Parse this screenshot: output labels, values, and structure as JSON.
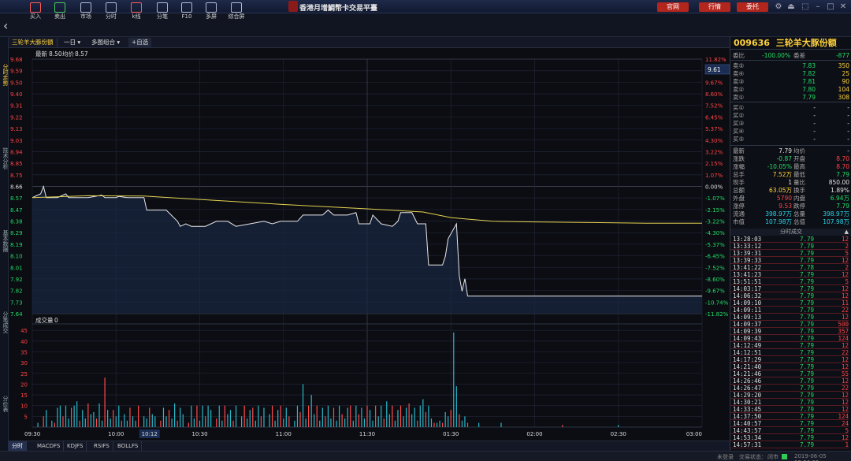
{
  "app": {
    "title": "香港月增鯛幣卡交易平臺"
  },
  "top_buttons": [
    "官网",
    "行情",
    "委托"
  ],
  "toolbar": [
    {
      "label": "买入",
      "icon": "house-icon"
    },
    {
      "label": "卖出",
      "icon": "house-icon"
    },
    {
      "label": "市场",
      "icon": "bag-icon"
    },
    {
      "label": "分时",
      "icon": "chart-icon"
    },
    {
      "label": "k线",
      "icon": "candle-icon"
    },
    {
      "label": "分笔",
      "icon": "list-icon"
    },
    {
      "label": "F10",
      "icon": "doc-icon"
    },
    {
      "label": "多屏",
      "icon": "window-icon"
    },
    {
      "label": "综合屏",
      "icon": "grid-icon"
    }
  ],
  "left_tabs": [
    "分时走势",
    "技术分析",
    "基本数据",
    "分笔成交",
    "分价表"
  ],
  "subtabs": {
    "stock": "三轮羊大豚份額",
    "period": "一日",
    "overlay": "多图组合",
    "add": "+自选"
  },
  "info_line": {
    "last_label": "最新",
    "last": "8.50",
    "avg_label": "均价",
    "avg": "8.57"
  },
  "current_price_tag": "9.61",
  "volume_label": "成交量",
  "volume_value": "0",
  "bottom_tabs": [
    "分时",
    "MACDFS",
    "KDJFS",
    "RSIFS",
    "BOLLFS"
  ],
  "status": {
    "left": "未登录",
    "state_label": "交易状态：",
    "state": "闭市",
    "datetime": "2019-06-05 15:26:32"
  },
  "chart_data": {
    "type": "line",
    "x_ticks": [
      "09:30",
      "10:00",
      "10:12",
      "10:30",
      "11:00",
      "11:30",
      "01:30",
      "02:00",
      "02:30",
      "03:00"
    ],
    "price_ticks": [
      "9.68",
      "9.59",
      "9.50",
      "9.40",
      "9.31",
      "9.22",
      "9.13",
      "9.03",
      "8.94",
      "8.85",
      "8.75",
      "8.66",
      "8.57",
      "8.47",
      "8.38",
      "8.29",
      "8.19",
      "8.10",
      "8.01",
      "7.92",
      "7.82",
      "7.73",
      "7.64"
    ],
    "pct_ticks": [
      "11.82%",
      "10.74%",
      "9.67%",
      "8.60%",
      "7.52%",
      "6.45%",
      "5.37%",
      "4.30%",
      "3.22%",
      "2.15%",
      "1.07%",
      "0.00%",
      "-1.07%",
      "-2.15%",
      "-3.22%",
      "-4.30%",
      "-5.37%",
      "-6.45%",
      "-7.52%",
      "-8.60%",
      "-9.67%",
      "-10.74%",
      "-11.82%"
    ],
    "ylim": [
      7.64,
      9.68
    ],
    "prev_close": 8.66,
    "volume_ticks": [
      "45",
      "40",
      "35",
      "30",
      "25",
      "20",
      "15",
      "10",
      "5"
    ],
    "volume_ylim": [
      0,
      48
    ],
    "price_series": [
      [
        0,
        8.57
      ],
      [
        3,
        8.6
      ],
      [
        4,
        8.66
      ],
      [
        5,
        8.57
      ],
      [
        9,
        8.57
      ],
      [
        12,
        8.6
      ],
      [
        13,
        8.57
      ],
      [
        20,
        8.57
      ],
      [
        25,
        8.59
      ],
      [
        26,
        8.57
      ],
      [
        30,
        8.57
      ],
      [
        31,
        8.58
      ],
      [
        34,
        8.57
      ],
      [
        40,
        8.57
      ],
      [
        41,
        8.47
      ],
      [
        48,
        8.47
      ],
      [
        52,
        8.38
      ],
      [
        53,
        8.34
      ],
      [
        55,
        8.36
      ],
      [
        57,
        8.34
      ],
      [
        62,
        8.34
      ],
      [
        66,
        8.38
      ],
      [
        70,
        8.38
      ],
      [
        73,
        8.34
      ],
      [
        78,
        8.36
      ],
      [
        83,
        8.38
      ],
      [
        86,
        8.36
      ],
      [
        89,
        8.38
      ],
      [
        92,
        8.38
      ],
      [
        95,
        8.38
      ],
      [
        97,
        8.43
      ],
      [
        104,
        8.43
      ],
      [
        106,
        8.47
      ],
      [
        108,
        8.43
      ],
      [
        113,
        8.43
      ],
      [
        116,
        8.45
      ],
      [
        117,
        8.36
      ],
      [
        121,
        8.36
      ],
      [
        122,
        8.43
      ],
      [
        125,
        8.36
      ],
      [
        129,
        8.34
      ],
      [
        131,
        8.38
      ],
      [
        132,
        8.45
      ],
      [
        136,
        8.45
      ],
      [
        138,
        8.36
      ],
      [
        141,
        8.36
      ],
      [
        142,
        8.03
      ],
      [
        147,
        8.03
      ],
      [
        148,
        8.1
      ],
      [
        149,
        8.24
      ],
      [
        152,
        8.36
      ],
      [
        153,
        7.94
      ],
      [
        154,
        7.82
      ],
      [
        155,
        7.92
      ],
      [
        156,
        7.78
      ],
      [
        240,
        7.78
      ]
    ],
    "avg_series": [
      [
        0,
        8.57
      ],
      [
        20,
        8.585
      ],
      [
        40,
        8.583
      ],
      [
        60,
        8.555
      ],
      [
        90,
        8.515
      ],
      [
        120,
        8.48
      ],
      [
        140,
        8.455
      ],
      [
        150,
        8.41
      ],
      [
        155,
        8.4
      ],
      [
        165,
        8.38
      ],
      [
        180,
        8.375
      ],
      [
        220,
        8.365
      ],
      [
        240,
        8.365
      ]
    ],
    "volume_bars": [
      [
        2,
        2
      ],
      [
        4,
        5
      ],
      [
        5,
        8
      ],
      [
        7,
        3
      ],
      [
        8,
        2
      ],
      [
        9,
        9
      ],
      [
        10,
        10
      ],
      [
        11,
        5
      ],
      [
        12,
        10
      ],
      [
        13,
        4
      ],
      [
        14,
        9
      ],
      [
        15,
        10
      ],
      [
        16,
        12
      ],
      [
        17,
        3
      ],
      [
        18,
        8
      ],
      [
        19,
        4
      ],
      [
        20,
        11
      ],
      [
        21,
        6
      ],
      [
        22,
        7
      ],
      [
        23,
        4
      ],
      [
        24,
        11
      ],
      [
        25,
        3
      ],
      [
        26,
        23
      ],
      [
        27,
        8
      ],
      [
        28,
        4
      ],
      [
        29,
        8
      ],
      [
        30,
        5
      ],
      [
        31,
        10
      ],
      [
        32,
        3
      ],
      [
        33,
        6
      ],
      [
        34,
        3
      ],
      [
        35,
        9
      ],
      [
        36,
        5
      ],
      [
        37,
        3
      ],
      [
        38,
        10
      ],
      [
        40,
        5
      ],
      [
        41,
        4
      ],
      [
        42,
        9
      ],
      [
        43,
        6
      ],
      [
        44,
        5
      ],
      [
        46,
        3
      ],
      [
        47,
        9
      ],
      [
        48,
        5
      ],
      [
        49,
        8
      ],
      [
        50,
        4
      ],
      [
        51,
        11
      ],
      [
        52,
        3
      ],
      [
        53,
        9
      ],
      [
        54,
        6
      ],
      [
        56,
        2
      ],
      [
        57,
        10
      ],
      [
        58,
        4
      ],
      [
        59,
        10
      ],
      [
        60,
        3
      ],
      [
        61,
        10
      ],
      [
        62,
        5
      ],
      [
        63,
        10
      ],
      [
        64,
        8
      ],
      [
        66,
        4
      ],
      [
        67,
        10
      ],
      [
        68,
        3
      ],
      [
        69,
        10
      ],
      [
        70,
        6
      ],
      [
        71,
        8
      ],
      [
        72,
        3
      ],
      [
        73,
        10
      ],
      [
        75,
        5
      ],
      [
        76,
        10
      ],
      [
        77,
        4
      ],
      [
        78,
        8
      ],
      [
        79,
        9
      ],
      [
        80,
        3
      ],
      [
        81,
        10
      ],
      [
        82,
        5
      ],
      [
        83,
        9
      ],
      [
        85,
        6
      ],
      [
        86,
        10
      ],
      [
        87,
        3
      ],
      [
        88,
        8
      ],
      [
        89,
        10
      ],
      [
        90,
        4
      ],
      [
        91,
        9
      ],
      [
        92,
        5
      ],
      [
        94,
        3
      ],
      [
        95,
        10
      ],
      [
        96,
        7
      ],
      [
        97,
        20
      ],
      [
        98,
        4
      ],
      [
        99,
        10
      ],
      [
        100,
        15
      ],
      [
        101,
        6
      ],
      [
        102,
        10
      ],
      [
        103,
        3
      ],
      [
        104,
        9
      ],
      [
        105,
        5
      ],
      [
        106,
        10
      ],
      [
        107,
        4
      ],
      [
        108,
        9
      ],
      [
        109,
        3
      ],
      [
        110,
        10
      ],
      [
        111,
        6
      ],
      [
        112,
        4
      ],
      [
        113,
        9
      ],
      [
        114,
        10
      ],
      [
        115,
        3
      ],
      [
        116,
        10
      ],
      [
        117,
        6
      ],
      [
        118,
        9
      ],
      [
        119,
        4
      ],
      [
        120,
        10
      ],
      [
        121,
        8
      ],
      [
        122,
        3
      ],
      [
        123,
        10
      ],
      [
        124,
        5
      ],
      [
        125,
        10
      ],
      [
        126,
        4
      ],
      [
        127,
        12
      ],
      [
        128,
        6
      ],
      [
        129,
        10
      ],
      [
        130,
        3
      ],
      [
        131,
        8
      ],
      [
        132,
        10
      ],
      [
        133,
        5
      ],
      [
        134,
        9
      ],
      [
        135,
        11
      ],
      [
        136,
        6
      ],
      [
        137,
        9
      ],
      [
        138,
        3
      ],
      [
        139,
        10
      ],
      [
        140,
        13
      ],
      [
        141,
        7
      ],
      [
        142,
        10
      ],
      [
        143,
        4
      ],
      [
        144,
        2
      ],
      [
        145,
        2
      ],
      [
        146,
        3
      ],
      [
        147,
        2
      ],
      [
        148,
        7
      ],
      [
        149,
        5
      ],
      [
        150,
        8
      ],
      [
        151,
        44
      ],
      [
        152,
        19
      ],
      [
        153,
        6
      ],
      [
        154,
        3
      ],
      [
        155,
        5
      ],
      [
        156,
        2
      ],
      [
        160,
        2
      ],
      [
        168,
        2
      ],
      [
        190,
        1
      ],
      [
        210,
        1
      ]
    ]
  },
  "quote": {
    "code": "009636",
    "name": "三轮羊大豚份额",
    "weibi_label": "委比",
    "weibi": "-100.00%",
    "weicha_label": "委差",
    "weicha": "-877",
    "asks": [
      {
        "label": "卖⑤",
        "price": "7.83",
        "vol": "350"
      },
      {
        "label": "卖④",
        "price": "7.82",
        "vol": "25"
      },
      {
        "label": "卖③",
        "price": "7.81",
        "vol": "90"
      },
      {
        "label": "卖②",
        "price": "7.80",
        "vol": "104"
      },
      {
        "label": "卖①",
        "price": "7.79",
        "vol": "308"
      }
    ],
    "bids": [
      {
        "label": "买①",
        "price": "-",
        "vol": "-"
      },
      {
        "label": "买②",
        "price": "-",
        "vol": "-"
      },
      {
        "label": "买③",
        "price": "-",
        "vol": "-"
      },
      {
        "label": "买④",
        "price": "-",
        "vol": "-"
      },
      {
        "label": "买⑤",
        "price": "-",
        "vol": "-"
      }
    ],
    "stats": [
      {
        "l1": "最新",
        "v1": "7.79",
        "l2": "均价",
        "v2": "-"
      },
      {
        "l1": "涨跌",
        "v1": "-0.87",
        "l2": "开盘",
        "v2": "8.70"
      },
      {
        "l1": "涨幅",
        "v1": "-10.05%",
        "l2": "最高",
        "v2": "8.70"
      },
      {
        "l1": "总手",
        "v1": "7.52万",
        "l2": "最低",
        "v2": "7.79"
      },
      {
        "l1": "现手",
        "v1": "1",
        "l2": "量比",
        "v2": "850.00"
      },
      {
        "l1": "总额",
        "v1": "63.05万",
        "l2": "换手",
        "v2": "1.89%"
      },
      {
        "l1": "外盘",
        "v1": "5790",
        "l2": "内盘",
        "v2": "6.94万"
      },
      {
        "l1": "涨停",
        "v1": "9.53",
        "l2": "跌停",
        "v2": "7.79"
      },
      {
        "l1": "流通",
        "v1": "398.97万",
        "l2": "总量",
        "v2": "398.97万"
      },
      {
        "l1": "市值",
        "v1": "107.98万",
        "l2": "总值",
        "v2": "107.98万"
      }
    ],
    "trades_title": "分时成交",
    "trades": [
      {
        "time": "13:28:03",
        "price": "7.79",
        "vol": "12"
      },
      {
        "time": "13:33:12",
        "price": "7.79",
        "vol": "2"
      },
      {
        "time": "13:39:31",
        "price": "7.79",
        "vol": "5"
      },
      {
        "time": "13:39:33",
        "price": "7.79",
        "vol": "12"
      },
      {
        "time": "13:41:22",
        "price": "7.78",
        "vol": "2"
      },
      {
        "time": "13:41:23",
        "price": "7.79",
        "vol": "12"
      },
      {
        "time": "13:51:51",
        "price": "7.79",
        "vol": "5"
      },
      {
        "time": "14:03:17",
        "price": "7.79",
        "vol": "12"
      },
      {
        "time": "14:06:32",
        "price": "7.79",
        "vol": "12"
      },
      {
        "time": "14:09:10",
        "price": "7.79",
        "vol": "11"
      },
      {
        "time": "14:09:11",
        "price": "7.79",
        "vol": "22"
      },
      {
        "time": "14:09:13",
        "price": "7.79",
        "vol": "12"
      },
      {
        "time": "14:09:37",
        "price": "7.79",
        "vol": "500"
      },
      {
        "time": "14:09:39",
        "price": "7.79",
        "vol": "357"
      },
      {
        "time": "14:09:43",
        "price": "7.79",
        "vol": "124"
      },
      {
        "time": "14:12:49",
        "price": "7.79",
        "vol": "12"
      },
      {
        "time": "14:12:51",
        "price": "7.79",
        "vol": "22"
      },
      {
        "time": "14:17:29",
        "price": "7.79",
        "vol": "12"
      },
      {
        "time": "14:21:40",
        "price": "7.79",
        "vol": "12"
      },
      {
        "time": "14:21:46",
        "price": "7.79",
        "vol": "55"
      },
      {
        "time": "14:26:46",
        "price": "7.79",
        "vol": "12"
      },
      {
        "time": "14:26:47",
        "price": "7.79",
        "vol": "22"
      },
      {
        "time": "14:29:20",
        "price": "7.79",
        "vol": "12"
      },
      {
        "time": "14:30:21",
        "price": "7.79",
        "vol": "12"
      },
      {
        "time": "14:33:45",
        "price": "7.79",
        "vol": "12"
      },
      {
        "time": "14:37:50",
        "price": "7.79",
        "vol": "124"
      },
      {
        "time": "14:40:57",
        "price": "7.79",
        "vol": "24"
      },
      {
        "time": "14:43:57",
        "price": "7.79",
        "vol": "5"
      },
      {
        "time": "14:53:34",
        "price": "7.79",
        "vol": "12"
      },
      {
        "time": "14:57:31",
        "price": "7.79",
        "vol": "1"
      }
    ]
  }
}
